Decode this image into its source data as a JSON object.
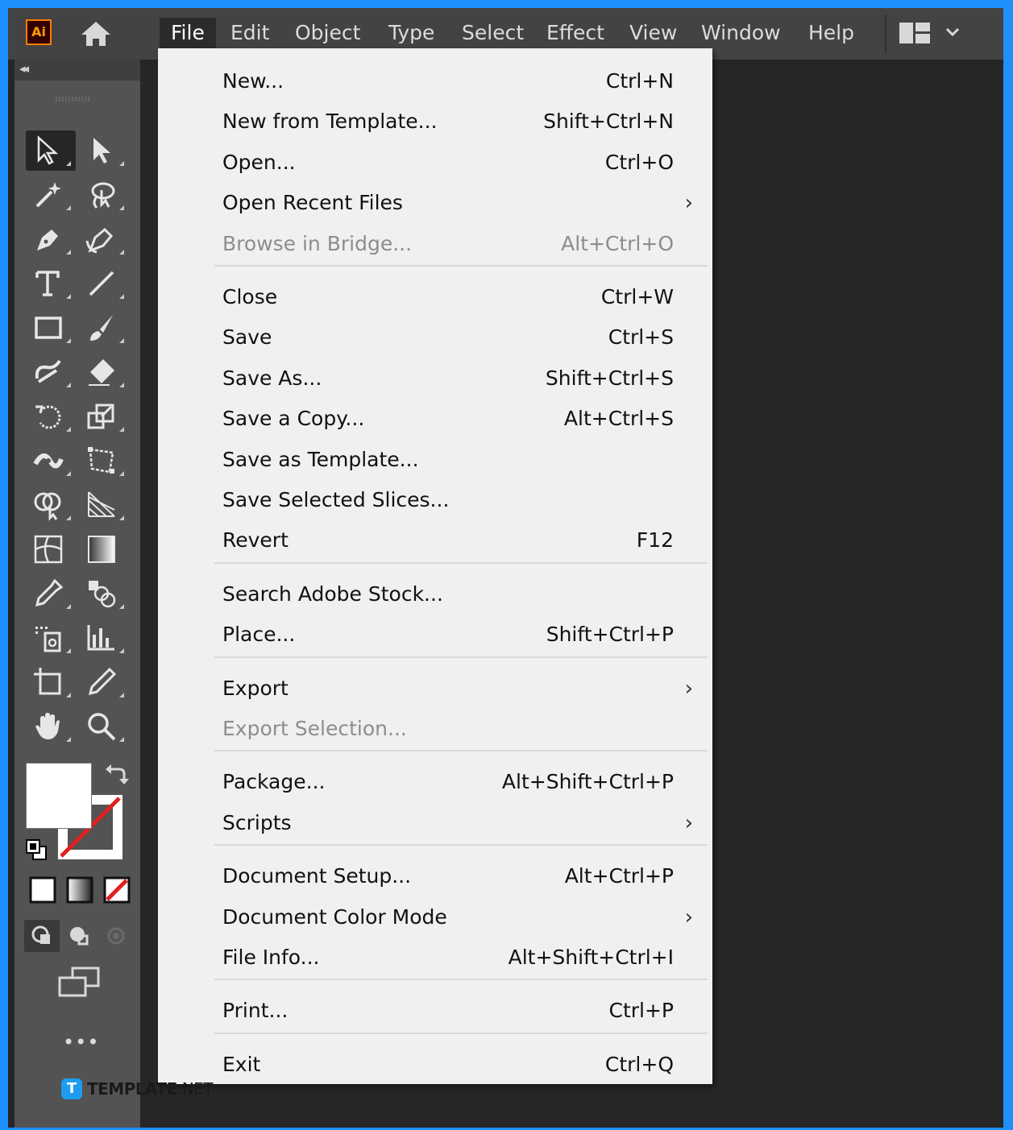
{
  "app": {
    "logo": "Ai",
    "menubar": [
      {
        "label": "File",
        "active": true
      },
      {
        "label": "Edit"
      },
      {
        "label": "Object"
      },
      {
        "label": "Type"
      },
      {
        "label": "Select"
      },
      {
        "label": "Effect"
      },
      {
        "label": "View"
      },
      {
        "label": "Window"
      },
      {
        "label": "Help"
      }
    ]
  },
  "toolbar": {
    "tools": [
      {
        "name": "selection-tool-icon",
        "selected": true
      },
      {
        "name": "direct-selection-tool-icon"
      },
      {
        "name": "magic-wand-tool-icon"
      },
      {
        "name": "lasso-tool-icon"
      },
      {
        "name": "pen-tool-icon"
      },
      {
        "name": "curvature-tool-icon"
      },
      {
        "name": "type-tool-icon"
      },
      {
        "name": "line-segment-tool-icon"
      },
      {
        "name": "rectangle-tool-icon"
      },
      {
        "name": "paintbrush-tool-icon"
      },
      {
        "name": "shaper-tool-icon"
      },
      {
        "name": "eraser-tool-icon"
      },
      {
        "name": "rotate-tool-icon"
      },
      {
        "name": "scale-tool-icon"
      },
      {
        "name": "width-tool-icon"
      },
      {
        "name": "free-transform-tool-icon"
      },
      {
        "name": "shape-builder-tool-icon"
      },
      {
        "name": "perspective-grid-tool-icon"
      },
      {
        "name": "mesh-tool-icon"
      },
      {
        "name": "gradient-tool-icon"
      },
      {
        "name": "eyedropper-tool-icon"
      },
      {
        "name": "blend-tool-icon"
      },
      {
        "name": "symbol-sprayer-tool-icon"
      },
      {
        "name": "column-graph-tool-icon"
      },
      {
        "name": "artboard-tool-icon"
      },
      {
        "name": "slice-tool-icon"
      },
      {
        "name": "hand-tool-icon"
      },
      {
        "name": "zoom-tool-icon"
      }
    ],
    "more_label": "•••"
  },
  "file_menu": {
    "items": [
      {
        "label": "New...",
        "shortcut": "Ctrl+N"
      },
      {
        "label": "New from Template...",
        "shortcut": "Shift+Ctrl+N"
      },
      {
        "label": "Open...",
        "shortcut": "Ctrl+O"
      },
      {
        "label": "Open Recent Files",
        "shortcut": "",
        "submenu": true
      },
      {
        "label": "Browse in Bridge...",
        "shortcut": "Alt+Ctrl+O",
        "disabled": true
      },
      {
        "separator": true
      },
      {
        "label": "Close",
        "shortcut": "Ctrl+W"
      },
      {
        "label": "Save",
        "shortcut": "Ctrl+S"
      },
      {
        "label": "Save As...",
        "shortcut": "Shift+Ctrl+S"
      },
      {
        "label": "Save a Copy...",
        "shortcut": "Alt+Ctrl+S"
      },
      {
        "label": "Save as Template...",
        "shortcut": ""
      },
      {
        "label": "Save Selected Slices...",
        "shortcut": ""
      },
      {
        "label": "Revert",
        "shortcut": "F12"
      },
      {
        "separator": true
      },
      {
        "label": "Search Adobe Stock...",
        "shortcut": ""
      },
      {
        "label": "Place...",
        "shortcut": "Shift+Ctrl+P"
      },
      {
        "separator": true
      },
      {
        "label": "Export",
        "shortcut": "",
        "submenu": true
      },
      {
        "label": "Export Selection...",
        "shortcut": "",
        "disabled": true
      },
      {
        "separator": true
      },
      {
        "label": "Package...",
        "shortcut": "Alt+Shift+Ctrl+P"
      },
      {
        "label": "Scripts",
        "shortcut": "",
        "submenu": true
      },
      {
        "separator": true
      },
      {
        "label": "Document Setup...",
        "shortcut": "Alt+Ctrl+P"
      },
      {
        "label": "Document Color Mode",
        "shortcut": "",
        "submenu": true
      },
      {
        "label": "File Info...",
        "shortcut": "Alt+Shift+Ctrl+I"
      },
      {
        "separator": true
      },
      {
        "label": "Print...",
        "shortcut": "Ctrl+P"
      },
      {
        "separator": true
      },
      {
        "label": "Exit",
        "shortcut": "Ctrl+Q"
      }
    ]
  },
  "watermark": {
    "icon_letter": "T",
    "text_bold": "TEMPLATE",
    "text_thin": ".NET"
  },
  "colors": {
    "frame_border": "#1e90ff",
    "menubar": "#434343",
    "toolbar": "#535353",
    "canvas": "#262626",
    "dropdown": "#f0f0f0",
    "logo_accent": "#ff7c00",
    "none_stroke_red": "#e02020"
  }
}
